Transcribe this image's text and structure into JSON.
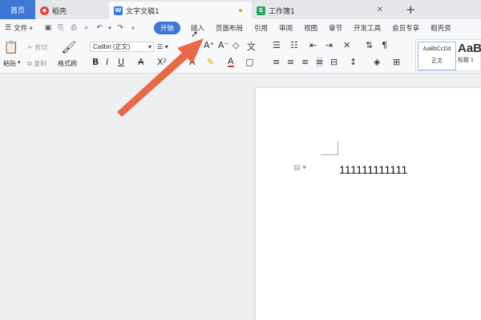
{
  "tabs": {
    "home": "首页",
    "straw": "稻壳",
    "doc": "文字文稿1",
    "sheet": "工作簿1",
    "new": "+"
  },
  "menu": {
    "file": "文件",
    "items": [
      "开始",
      "插入",
      "页面布局",
      "引用",
      "审阅",
      "视图",
      "章节",
      "开发工具",
      "会员专享",
      "稻壳资"
    ]
  },
  "ribbon": {
    "paste": "粘贴",
    "cut": "剪切",
    "copy": "复制",
    "format_painter": "格式刷",
    "font_name": "Calibri (正文)",
    "font_size_dropdown": "▾",
    "styles": [
      {
        "preview": "AaBbCcDd",
        "caption": "正文"
      },
      {
        "preview": "AaB",
        "caption": "标题 1"
      }
    ]
  },
  "document": {
    "text": "111111111111"
  },
  "colors": {
    "accent": "#3d78d6",
    "arrow": "#e8694a"
  }
}
